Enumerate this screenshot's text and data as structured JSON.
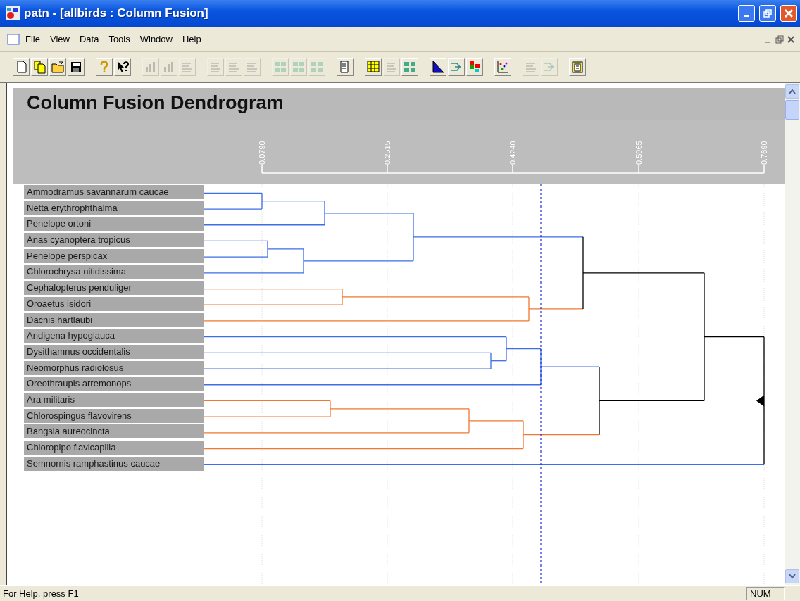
{
  "window": {
    "title": "patn - [allbirds : Column Fusion]"
  },
  "menu": [
    "File",
    "View",
    "Data",
    "Tools",
    "Window",
    "Help"
  ],
  "toolbar": [
    {
      "kind": "new",
      "disabled": false
    },
    {
      "kind": "copy",
      "disabled": false
    },
    {
      "kind": "open",
      "disabled": false
    },
    {
      "kind": "save",
      "disabled": false
    },
    {
      "kind": "sep"
    },
    {
      "kind": "help",
      "disabled": false
    },
    {
      "kind": "context-help",
      "disabled": false
    },
    {
      "kind": "sep"
    },
    {
      "kind": "bars",
      "disabled": true
    },
    {
      "kind": "bars",
      "disabled": true
    },
    {
      "kind": "lines",
      "disabled": true
    },
    {
      "kind": "sep"
    },
    {
      "kind": "lines",
      "disabled": true
    },
    {
      "kind": "lines",
      "disabled": true
    },
    {
      "kind": "lines",
      "disabled": true
    },
    {
      "kind": "sep"
    },
    {
      "kind": "grid",
      "disabled": true
    },
    {
      "kind": "grid",
      "disabled": true
    },
    {
      "kind": "grid",
      "disabled": true
    },
    {
      "kind": "sep"
    },
    {
      "kind": "report",
      "disabled": false
    },
    {
      "kind": "sep"
    },
    {
      "kind": "table",
      "disabled": false
    },
    {
      "kind": "lines",
      "disabled": true
    },
    {
      "kind": "grid",
      "disabled": false
    },
    {
      "kind": "sep"
    },
    {
      "kind": "triangle",
      "disabled": false
    },
    {
      "kind": "arrows",
      "disabled": false
    },
    {
      "kind": "colors",
      "disabled": false
    },
    {
      "kind": "sep"
    },
    {
      "kind": "scatter",
      "disabled": false
    },
    {
      "kind": "sep"
    },
    {
      "kind": "lines",
      "disabled": true
    },
    {
      "kind": "arrows",
      "disabled": true
    },
    {
      "kind": "sep"
    },
    {
      "kind": "clipboard",
      "disabled": false
    }
  ],
  "chart": {
    "title": "Column Fusion Dendrogram",
    "axis_ticks": [
      "0.0790",
      "0.2515",
      "0.4240",
      "0.5965",
      "0.7690"
    ],
    "leaves": [
      "Ammodramus savannarum caucae",
      "Netta erythrophthalma",
      "Penelope ortoni",
      "Anas cyanoptera tropicus",
      "Penelope perspicax",
      "Chlorochrysa nitidissima",
      "Cephalopterus penduliger",
      "Oroaetus isidori",
      "Dacnis hartlaubi",
      "Andigena hypoglauca",
      "Dysithamnus occidentalis",
      "Neomorphus radiolosus",
      "Oreothraupis arremonops",
      "Ara militaris",
      "Chlorospingus flavovirens",
      "Bangsia aureocincta",
      "Chloropipo flavicapilla",
      "Semnornis ramphastinus caucae"
    ]
  },
  "status_bar": {
    "text": "For Help, press F1",
    "indicators": [
      "NUM"
    ]
  }
}
